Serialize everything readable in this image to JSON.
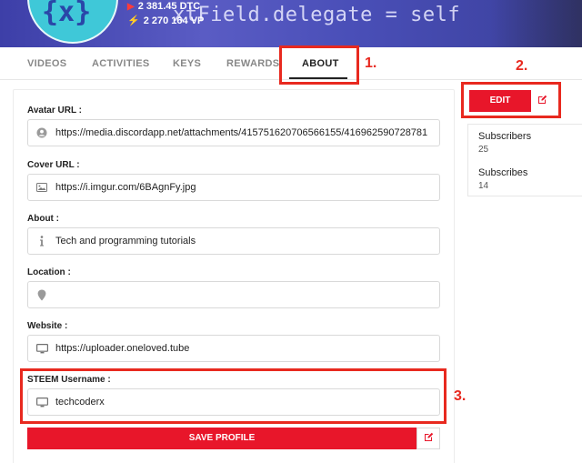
{
  "header": {
    "avatar_text": "{x}",
    "banner_code": "xtField.delegate = self",
    "dtc": "2 381.45 DTC",
    "vp": "2 270 164 VP"
  },
  "tabs": [
    {
      "label": "VIDEOS"
    },
    {
      "label": "ACTIVITIES"
    },
    {
      "label": "KEYS"
    },
    {
      "label": "REWARDS"
    },
    {
      "label": "ABOUT",
      "active": true
    }
  ],
  "annotations": {
    "one": "1.",
    "two": "2.",
    "three": "3."
  },
  "form": {
    "avatar_url_label": "Avatar URL :",
    "avatar_url_value": "https://media.discordapp.net/attachments/415751620706566155/416962590728781",
    "cover_url_label": "Cover URL :",
    "cover_url_value": "https://i.imgur.com/6BAgnFy.jpg",
    "about_label": "About :",
    "about_value": "Tech and programming tutorials",
    "location_label": "Location :",
    "location_value": "",
    "website_label": "Website :",
    "website_value": "https://uploader.oneloved.tube",
    "steem_label": "STEEM Username :",
    "steem_value": "techcoderx",
    "save_label": "SAVE PROFILE"
  },
  "sidebar": {
    "edit_label": "EDIT",
    "subscribers_label": "Subscribers",
    "subscribers_value": "25",
    "subscribes_label": "Subscribes",
    "subscribes_value": "14"
  },
  "colors": {
    "accent_red": "#e8162a",
    "annotation_red": "#e8291f"
  },
  "icons": [
    "user-icon",
    "image-icon",
    "info-icon",
    "map-pin-icon",
    "monitor-icon",
    "edit-icon",
    "play-icon",
    "bolt-icon"
  ]
}
